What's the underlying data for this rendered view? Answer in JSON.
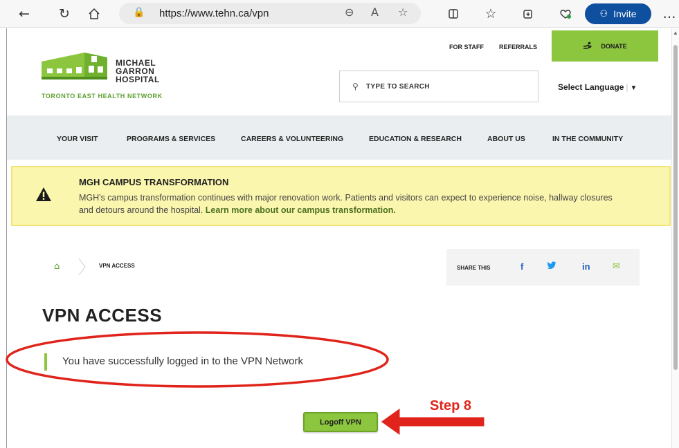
{
  "browser": {
    "url": "https://www.tehn.ca/vpn",
    "invite_label": "Invite",
    "more_label": "…"
  },
  "header": {
    "logo_line1": "MICHAEL",
    "logo_line2": "GARRON",
    "logo_line3": "HOSPITAL",
    "logo_subtitle": "TORONTO EAST HEALTH NETWORK",
    "for_staff": "FOR STAFF",
    "referrals": "REFERRALS",
    "donate": "DONATE",
    "search_placeholder": "TYPE TO SEARCH",
    "language": "Select Language"
  },
  "nav": {
    "items": [
      "YOUR VISIT",
      "PROGRAMS & SERVICES",
      "CAREERS & VOLUNTEERING",
      "EDUCATION & RESEARCH",
      "ABOUT US",
      "IN THE COMMUNITY"
    ]
  },
  "alert": {
    "title": "MGH CAMPUS TRANSFORMATION",
    "text": "MGH's campus transformation continues with major renovation work. Patients and visitors can expect to experience noise, hallway closures and detours around the hospital.",
    "link": "Learn more about our campus transformation."
  },
  "breadcrumb": {
    "current": "VPN ACCESS"
  },
  "share": {
    "label": "SHARE THIS",
    "facebook": "f",
    "twitter": "🐦",
    "linkedin": "in",
    "email": "✉"
  },
  "main": {
    "title": "VPN ACCESS",
    "message": "You have successfully logged in to the VPN Network",
    "logoff_button": "Logoff VPN"
  },
  "annotation": {
    "step": "Step 8",
    "color": "#e0241b"
  },
  "colors": {
    "brand_green": "#8cc63f",
    "alert_yellow": "#fbf6ae",
    "invite_blue": "#0f4f9f"
  }
}
